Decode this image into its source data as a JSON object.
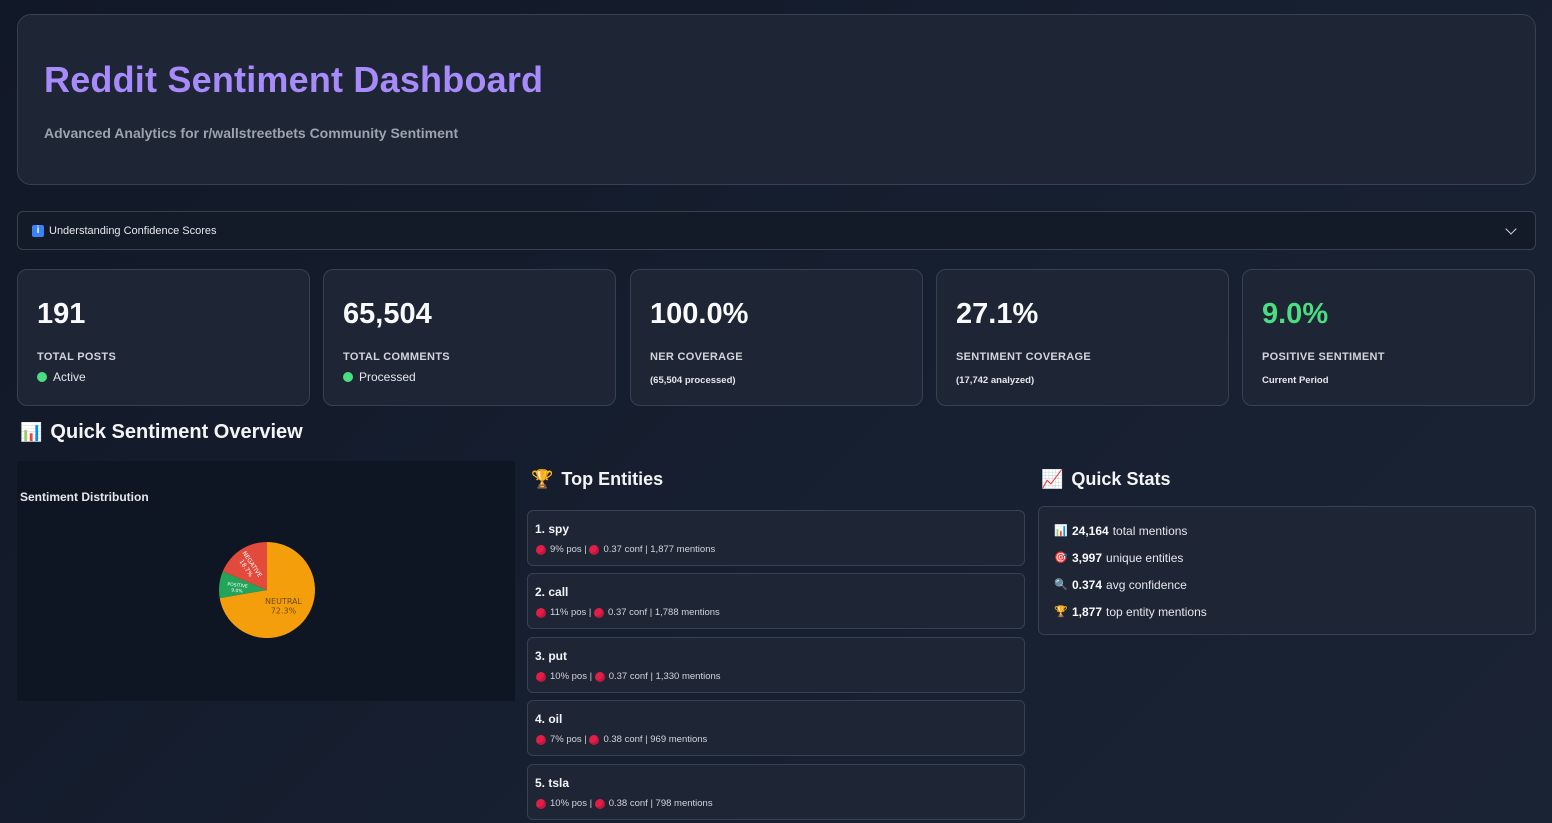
{
  "header": {
    "title": "Reddit Sentiment Dashboard",
    "subtitle": "Advanced Analytics for r/wallstreetbets Community Sentiment"
  },
  "expander": {
    "label": "Understanding Confidence Scores",
    "icon": "info-icon"
  },
  "metrics": [
    {
      "value": "191",
      "label": "TOTAL POSTS",
      "sub": "Active"
    },
    {
      "value": "65,504",
      "label": "TOTAL COMMENTS",
      "sub": "Processed"
    },
    {
      "value": "100.0%",
      "label": "NER COVERAGE",
      "sub": "(65,504 processed)"
    },
    {
      "value": "27.1%",
      "label": "SENTIMENT COVERAGE",
      "sub": "(17,742 analyzed)"
    },
    {
      "value": "9.0%",
      "label": "POSITIVE SENTIMENT",
      "sub": "Current Period",
      "color": "#4ade80"
    }
  ],
  "sections": {
    "overview_title": "Quick Sentiment Overview",
    "entities_title": "Top Entities",
    "stats_title": "Quick Stats"
  },
  "chart_data": {
    "type": "pie",
    "title": "Sentiment Distribution",
    "categories": [
      "NEUTRAL",
      "POSITIVE",
      "NEGATIVE"
    ],
    "values": [
      72.3,
      9.0,
      18.7
    ],
    "labels": [
      "NEUTRAL\n72.3%",
      "POSITIVE\n9.0%",
      "NEGATIVE\n18.7%"
    ],
    "colors": [
      "#f59e0b",
      "#22a55a",
      "#e24a3b"
    ]
  },
  "entities": [
    {
      "name": "1. spy",
      "pos": "9% pos |",
      "meta": "0.37 conf | 1,877 mentions"
    },
    {
      "name": "2. call",
      "pos": "11% pos |",
      "meta": "0.37 conf | 1,788 mentions"
    },
    {
      "name": "3. put",
      "pos": "10% pos |",
      "meta": "0.37 conf | 1,330 mentions"
    },
    {
      "name": "4. oil",
      "pos": "7% pos |",
      "meta": "0.38 conf | 969 mentions"
    },
    {
      "name": "5. tsla",
      "pos": "10% pos |",
      "meta": "0.38 conf | 798 mentions"
    }
  ],
  "quick_stats": [
    {
      "icon": "bar-chart-icon",
      "value": "24,164",
      "text": "total mentions"
    },
    {
      "icon": "target-icon",
      "value": "3,997",
      "text": "unique entities"
    },
    {
      "icon": "magnifier-icon",
      "value": "0.374",
      "text": "avg confidence"
    },
    {
      "icon": "trophy-icon",
      "value": "1,877",
      "text": "top entity mentions"
    }
  ]
}
